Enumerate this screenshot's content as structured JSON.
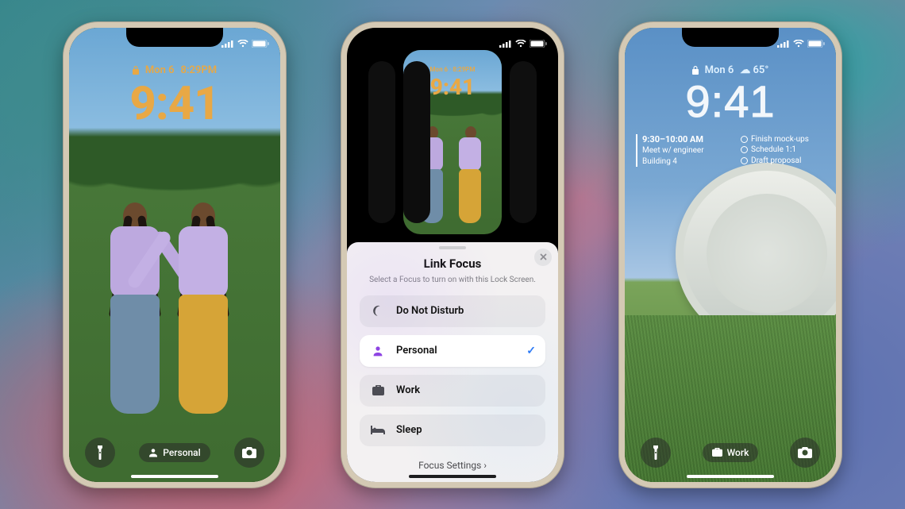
{
  "phone1": {
    "date_label": "Mon 6",
    "time_widget": "8:29PM",
    "clock_time": "9:41",
    "focus_chip": {
      "icon": "person-icon",
      "label": "Personal"
    },
    "flashlight_icon": "flashlight-icon",
    "camera_icon": "camera-icon"
  },
  "phone2": {
    "preview": {
      "date_label": "Mon 6 · 8:29PM",
      "clock_time": "9:41"
    },
    "sheet": {
      "title": "Link Focus",
      "subtitle": "Select a Focus to turn on with this Lock Screen.",
      "options": [
        {
          "icon": "moon-icon",
          "label": "Do Not Disturb",
          "selected": false,
          "color": "#6e56cf"
        },
        {
          "icon": "person-icon",
          "label": "Personal",
          "selected": true,
          "color": "#8e44e3"
        },
        {
          "icon": "briefcase-icon",
          "label": "Work",
          "selected": false,
          "color": "#2aa198"
        },
        {
          "icon": "bed-icon",
          "label": "Sleep",
          "selected": false,
          "color": "#36b37e"
        }
      ],
      "footer": "Focus Settings",
      "close_icon": "close-icon"
    }
  },
  "phone3": {
    "date_label": "Mon 6",
    "weather_widget": "☁︎ 65°",
    "clock_time": "9:41",
    "calendar": {
      "time": "9:30–10:00 AM",
      "title": "Meet w/ engineer",
      "location": "Building 4"
    },
    "reminders": [
      "Finish mock-ups",
      "Schedule 1:1",
      "Draft proposal"
    ],
    "focus_chip": {
      "icon": "briefcase-icon",
      "label": "Work"
    },
    "flashlight_icon": "flashlight-icon",
    "camera_icon": "camera-icon"
  }
}
